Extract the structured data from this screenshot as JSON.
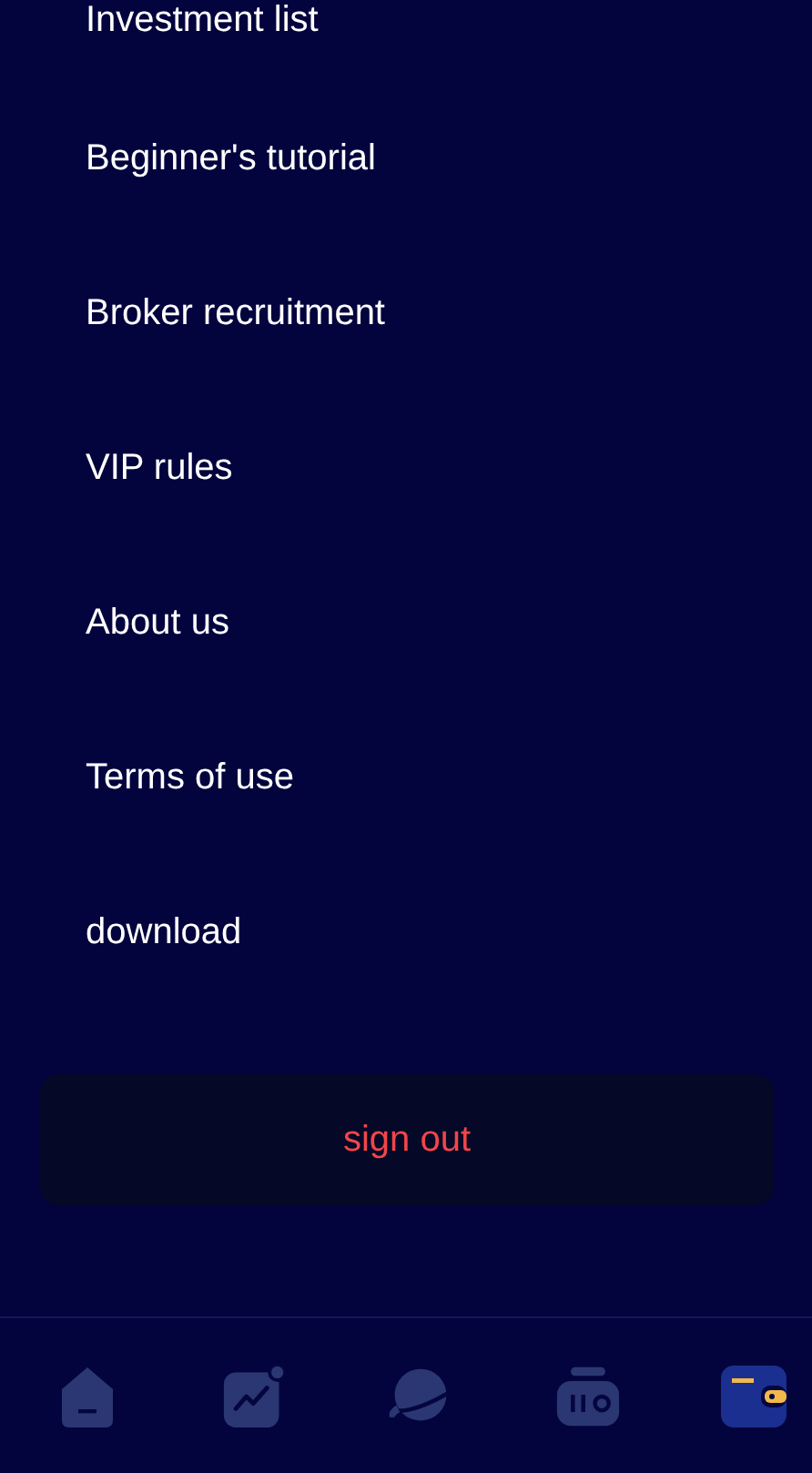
{
  "menu_items": [
    {
      "label": "Investment list"
    },
    {
      "label": "Beginner's tutorial"
    },
    {
      "label": "Broker recruitment"
    },
    {
      "label": "VIP rules"
    },
    {
      "label": "About us"
    },
    {
      "label": "Terms of use"
    },
    {
      "label": "download"
    }
  ],
  "sign_out_button": {
    "label": "sign out"
  },
  "bottom_nav": [
    {
      "kind": "home",
      "selected": false
    },
    {
      "kind": "chart",
      "selected": false
    },
    {
      "kind": "planet",
      "selected": false
    },
    {
      "kind": "box",
      "selected": false
    },
    {
      "kind": "wallet",
      "selected": true
    }
  ]
}
